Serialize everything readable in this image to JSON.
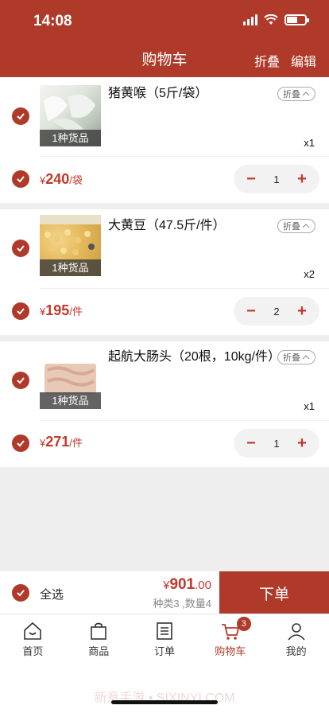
{
  "status_bar": {
    "time": "14:08"
  },
  "header": {
    "title": "购物车",
    "fold_all": "折叠",
    "edit": "编辑"
  },
  "items": [
    {
      "name": "猪黄喉（5斤/袋）",
      "thumb_label": "1种货品",
      "fold": "折叠",
      "qty_label": "x1",
      "price_currency": "¥",
      "price": "240",
      "unit": "/袋",
      "quantity": "1"
    },
    {
      "name": "大黄豆（47.5斤/件）",
      "thumb_label": "1种货品",
      "fold": "折叠",
      "qty_label": "x2",
      "price_currency": "¥",
      "price": "195",
      "unit": "/件",
      "quantity": "2"
    },
    {
      "name": "起航大肠头（20根，10kg/件）",
      "thumb_label": "1种货品",
      "fold": "折叠",
      "qty_label": "x1",
      "price_currency": "¥",
      "price": "271",
      "unit": "/件",
      "quantity": "1"
    }
  ],
  "footer": {
    "select_all": "全选",
    "total_currency": "¥",
    "total_int": "901",
    "total_dec": ".00",
    "summary": "种类3 ,数量4",
    "order_button": "下单"
  },
  "tabbar": {
    "tabs": [
      {
        "label": "首页",
        "icon": "home-icon"
      },
      {
        "label": "商品",
        "icon": "bag-icon"
      },
      {
        "label": "订单",
        "icon": "order-icon"
      },
      {
        "label": "购物车",
        "icon": "cart-icon",
        "badge": "3"
      },
      {
        "label": "我的",
        "icon": "user-icon"
      }
    ]
  },
  "watermark": "新意手游 • SIXINYI.COM",
  "colors": {
    "primary": "#b03a2a",
    "price": "#c0392b"
  }
}
